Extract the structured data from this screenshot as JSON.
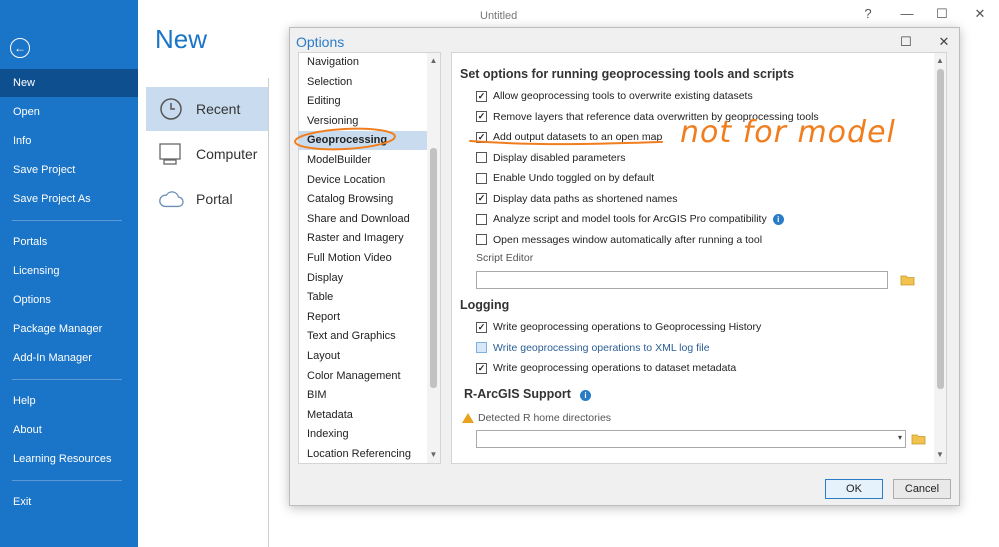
{
  "window": {
    "title": "Untitled",
    "help_glyph": "?",
    "minimize_glyph": "—",
    "maximize_glyph": "☐",
    "close_glyph": "✕"
  },
  "sidebar": {
    "back_icon": "back-arrow-icon",
    "items": [
      {
        "label": "New",
        "active": true
      },
      {
        "label": "Open"
      },
      {
        "label": "Info"
      },
      {
        "label": "Save Project"
      },
      {
        "label": "Save Project As"
      },
      {
        "label": "Portals"
      },
      {
        "label": "Licensing"
      },
      {
        "label": "Options"
      },
      {
        "label": "Package Manager"
      },
      {
        "label": "Add-In Manager"
      },
      {
        "label": "Help"
      },
      {
        "label": "About"
      },
      {
        "label": "Learning Resources"
      },
      {
        "label": "Exit"
      }
    ]
  },
  "page": {
    "title": "New",
    "items": [
      {
        "label": "Recent",
        "icon": "clock-icon",
        "active": true
      },
      {
        "label": "Computer",
        "icon": "computer-icon"
      },
      {
        "label": "Portal",
        "icon": "cloud-icon"
      }
    ]
  },
  "dialog": {
    "title": "Options",
    "maximize_glyph": "☐",
    "close_glyph": "✕",
    "nav_items": [
      "Navigation",
      "Selection",
      "Editing",
      "Versioning",
      "Geoprocessing",
      "ModelBuilder",
      "Device Location",
      "Catalog Browsing",
      "Share and Download",
      "Raster and Imagery",
      "Full Motion Video",
      "Display",
      "Table",
      "Report",
      "Text and Graphics",
      "Layout",
      "Color Management",
      "BIM",
      "Metadata",
      "Indexing",
      "Location Referencing"
    ],
    "nav_selected": "Geoprocessing",
    "main_heading": "Set options for running geoprocessing tools and scripts",
    "options": [
      {
        "label": "Allow geoprocessing tools to overwrite existing datasets",
        "checked": true
      },
      {
        "label": "Remove layers that reference data overwritten by geoprocessing tools",
        "checked": true
      },
      {
        "label": "Add output datasets to an open map",
        "checked": true
      },
      {
        "label": "Display disabled parameters",
        "checked": false
      },
      {
        "label": "Enable Undo toggled on by default",
        "checked": false
      },
      {
        "label": "Display data paths as shortened names",
        "checked": true
      },
      {
        "label": "Analyze script and model tools for ArcGIS Pro compatibility",
        "checked": false,
        "info": true
      },
      {
        "label": "Open messages window automatically after running a tool",
        "checked": false
      }
    ],
    "script_editor_label": "Script Editor",
    "script_editor_value": "",
    "logging_heading": "Logging",
    "logging_options": [
      {
        "label": "Write geoprocessing operations to Geoprocessing History",
        "checked": true
      },
      {
        "label": "Write geoprocessing operations to XML log file",
        "checked": false,
        "highlight": true
      },
      {
        "label": "Write geoprocessing operations to dataset metadata",
        "checked": true
      }
    ],
    "r_heading": "R-ArcGIS Support",
    "r_label": "Detected R home directories",
    "r_value": "",
    "ok_label": "OK",
    "cancel_label": "Cancel"
  },
  "annotation": {
    "text": "not for model",
    "color": "#f07e1f"
  },
  "colors": {
    "sidebar": "#1a74c7",
    "sidebar_active": "#0e4f8f",
    "selection": "#c9dcef",
    "accent": "#2a7cc7"
  }
}
